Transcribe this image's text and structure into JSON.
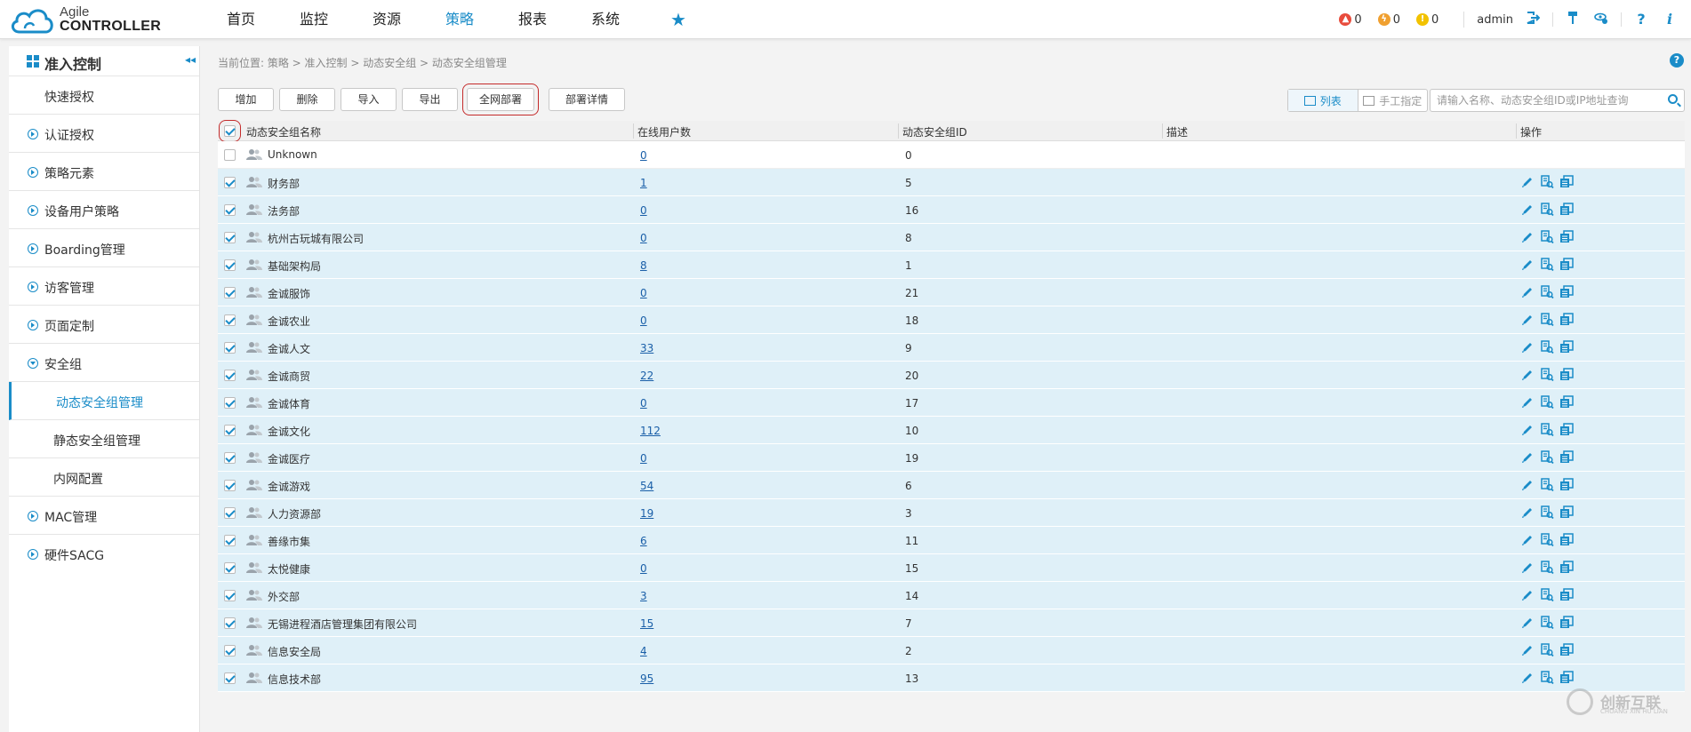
{
  "brand": {
    "line1": "Agile",
    "line2": "CONTROLLER"
  },
  "nav": [
    {
      "label": "首页",
      "active": false
    },
    {
      "label": "监控",
      "active": false
    },
    {
      "label": "资源",
      "active": false
    },
    {
      "label": "策略",
      "active": true
    },
    {
      "label": "报表",
      "active": false
    },
    {
      "label": "系统",
      "active": false
    }
  ],
  "nav_star": "★",
  "alarms": [
    {
      "count": "0",
      "color": "#e84c3d",
      "icon": "flame-icon"
    },
    {
      "count": "0",
      "color": "#f0a030",
      "icon": "bolt-icon"
    },
    {
      "count": "0",
      "color": "#f2c200",
      "icon": "exclaim-icon"
    }
  ],
  "user": {
    "name": "admin"
  },
  "sidebar": {
    "title": "准入控制",
    "items": [
      {
        "label": "快速授权",
        "type": "plain"
      },
      {
        "label": "认证授权",
        "type": "group"
      },
      {
        "label": "策略元素",
        "type": "group"
      },
      {
        "label": "设备用户策略",
        "type": "group"
      },
      {
        "label": "Boarding管理",
        "type": "group"
      },
      {
        "label": "访客管理",
        "type": "group"
      },
      {
        "label": "页面定制",
        "type": "group"
      },
      {
        "label": "安全组",
        "type": "group-open"
      },
      {
        "label": "动态安全组管理",
        "type": "active"
      },
      {
        "label": "静态安全组管理",
        "type": "child"
      },
      {
        "label": "内网配置",
        "type": "child"
      },
      {
        "label": "MAC管理",
        "type": "group"
      },
      {
        "label": "硬件SACG",
        "type": "group"
      }
    ]
  },
  "breadcrumb": "当前位置: 策略 > 准入控制 > 动态安全组 > 动态安全组管理",
  "toolbar": {
    "buttons": [
      {
        "label": "增加",
        "name": "add-button"
      },
      {
        "label": "删除",
        "name": "delete-button"
      },
      {
        "label": "导入",
        "name": "import-button"
      },
      {
        "label": "导出",
        "name": "export-button"
      },
      {
        "label": "全网部署",
        "name": "deploy-all-button"
      },
      {
        "label": "部署详情",
        "name": "deploy-details-button"
      }
    ],
    "view_list": "列表",
    "view_manual": "手工指定",
    "search_placeholder": "请输入名称、动态安全组ID或IP地址查询"
  },
  "table": {
    "columns": [
      "动态安全组名称",
      "在线用户数",
      "动态安全组ID",
      "描述",
      "操作"
    ],
    "rows": [
      {
        "name": "Unknown",
        "online": "0",
        "id": "0",
        "selected": false,
        "ops": false
      },
      {
        "name": "财务部",
        "online": "1",
        "id": "5",
        "selected": true,
        "ops": true
      },
      {
        "name": "法务部",
        "online": "0",
        "id": "16",
        "selected": true,
        "ops": true
      },
      {
        "name": "杭州古玩城有限公司",
        "online": "0",
        "id": "8",
        "selected": true,
        "ops": true
      },
      {
        "name": "基础架构局",
        "online": "8",
        "id": "1",
        "selected": true,
        "ops": true
      },
      {
        "name": "金诚服饰",
        "online": "0",
        "id": "21",
        "selected": true,
        "ops": true
      },
      {
        "name": "金诚农业",
        "online": "0",
        "id": "18",
        "selected": true,
        "ops": true
      },
      {
        "name": "金诚人文",
        "online": "33",
        "id": "9",
        "selected": true,
        "ops": true
      },
      {
        "name": "金诚商贸",
        "online": "22",
        "id": "20",
        "selected": true,
        "ops": true
      },
      {
        "name": "金诚体育",
        "online": "0",
        "id": "17",
        "selected": true,
        "ops": true
      },
      {
        "name": "金诚文化",
        "online": "112",
        "id": "10",
        "selected": true,
        "ops": true
      },
      {
        "name": "金诚医疗",
        "online": "0",
        "id": "19",
        "selected": true,
        "ops": true
      },
      {
        "name": "金诚游戏",
        "online": "54",
        "id": "6",
        "selected": true,
        "ops": true
      },
      {
        "name": "人力资源部",
        "online": "19",
        "id": "3",
        "selected": true,
        "ops": true
      },
      {
        "name": "善缘市集",
        "online": "6",
        "id": "11",
        "selected": true,
        "ops": true
      },
      {
        "name": "太悦健康",
        "online": "0",
        "id": "15",
        "selected": true,
        "ops": true
      },
      {
        "name": "外交部",
        "online": "3",
        "id": "14",
        "selected": true,
        "ops": true
      },
      {
        "name": "无锡进程酒店管理集团有限公司",
        "online": "15",
        "id": "7",
        "selected": true,
        "ops": true
      },
      {
        "name": "信息安全局",
        "online": "4",
        "id": "2",
        "selected": true,
        "ops": true
      },
      {
        "name": "信息技术部",
        "online": "95",
        "id": "13",
        "selected": true,
        "ops": true
      }
    ]
  },
  "watermark": {
    "line1": "创新互联",
    "line2": "CHUANG XIN HU LIAN"
  },
  "colors": {
    "accent": "#1a8cc8",
    "selected_row": "#dff0f8",
    "highlight_border": "#c42b2b"
  }
}
